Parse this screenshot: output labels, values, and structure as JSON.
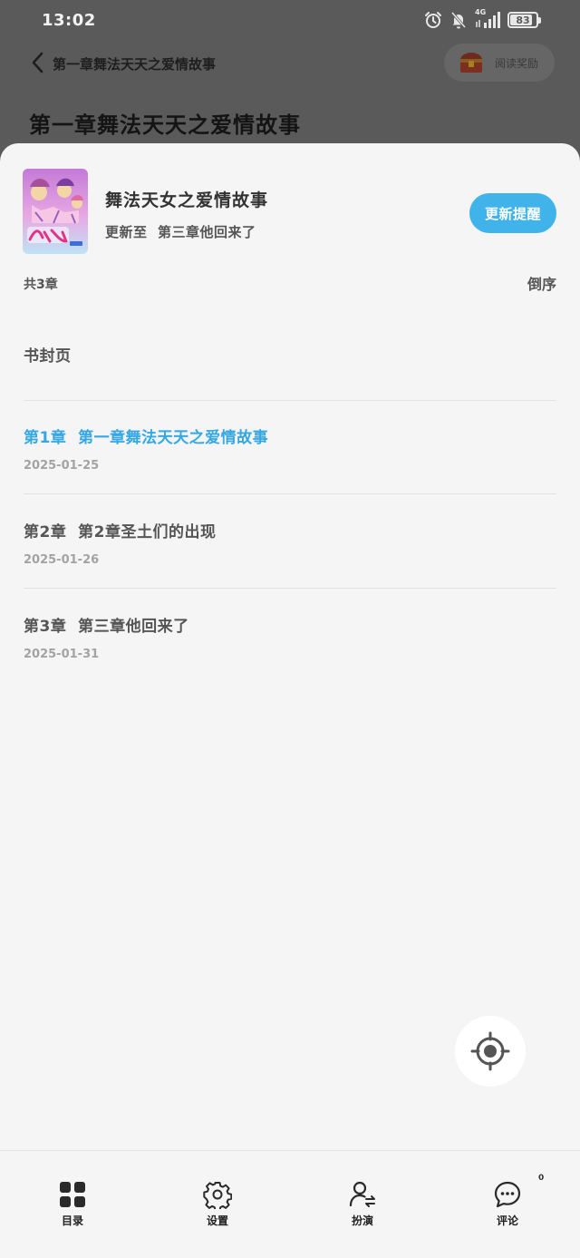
{
  "status_bar": {
    "time": "13:02",
    "network": "4G",
    "battery_level": "83",
    "icons": [
      "alarm-icon",
      "bell-off-icon",
      "signal-icon",
      "battery-icon"
    ]
  },
  "header": {
    "back_icon": "chevron-left-icon",
    "title": "第一章舞法天天之爱情故事",
    "reward_label": "阅读奖励",
    "reward_icon": "treasure-chest-icon"
  },
  "background": {
    "chapter_title": "第一章舞法天天之爱情故事"
  },
  "catalog": {
    "book_title": "舞法天女之爱情故事",
    "update_text": "更新至  第三章他回来了",
    "update_reminder_button": "更新提醒",
    "chapter_count": "共3章",
    "sort_label": "倒序",
    "cover_page_label": "书封页",
    "accent_color": "#3fb3ea",
    "chapters": [
      {
        "name": "第1章  第一章舞法天天之爱情故事",
        "date": "2025-01-25",
        "current": true
      },
      {
        "name": "第2章  第2章圣土们的出现",
        "date": "2025-01-26",
        "current": false
      },
      {
        "name": "第3章  第三章他回来了",
        "date": "2025-01-31",
        "current": false
      }
    ],
    "locate_icon": "locate-target-icon"
  },
  "bottom_nav": {
    "items": [
      {
        "label": "目录",
        "icon": "grid-icon"
      },
      {
        "label": "设置",
        "icon": "gear-icon"
      },
      {
        "label": "扮演",
        "icon": "person-swap-icon"
      },
      {
        "label": "评论",
        "icon": "comment-icon"
      }
    ],
    "comment_count": "0"
  }
}
